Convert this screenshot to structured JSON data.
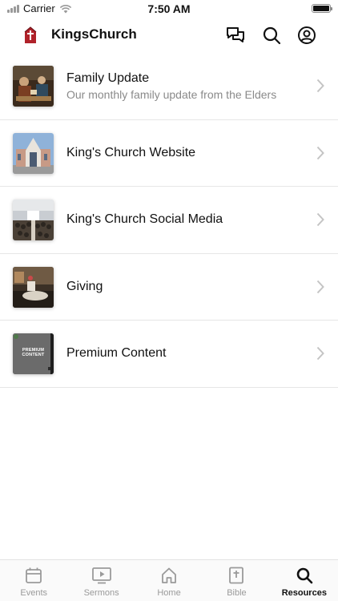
{
  "status_bar": {
    "carrier": "Carrier",
    "time": "7:50 AM"
  },
  "header": {
    "title": "KingsChurch",
    "logo_icon": "church-logo-icon",
    "actions": [
      {
        "name": "messages-icon"
      },
      {
        "name": "search-icon"
      },
      {
        "name": "profile-icon"
      }
    ]
  },
  "resources": [
    {
      "title": "Family Update",
      "subtitle": "Our monthly family update from the Elders",
      "thumb": "family-update-image"
    },
    {
      "title": "King's Church Website",
      "subtitle": "",
      "thumb": "church-building-image"
    },
    {
      "title": "King's Church Social Media",
      "subtitle": "",
      "thumb": "congregation-image"
    },
    {
      "title": "Giving",
      "subtitle": "",
      "thumb": "giving-image"
    },
    {
      "title": "Premium Content",
      "subtitle": "",
      "thumb": "premium-content-image",
      "thumb_text": "PREMIUM CONTENT"
    }
  ],
  "tabs": [
    {
      "label": "Events",
      "icon": "calendar-icon",
      "active": false
    },
    {
      "label": "Sermons",
      "icon": "video-play-icon",
      "active": false
    },
    {
      "label": "Home",
      "icon": "home-icon",
      "active": false
    },
    {
      "label": "Bible",
      "icon": "bible-icon",
      "active": false
    },
    {
      "label": "Resources",
      "icon": "search-icon",
      "active": true
    }
  ],
  "colors": {
    "brand": "#b0222a",
    "active_tab": "#111111",
    "inactive_tab": "#9a9a9a"
  }
}
